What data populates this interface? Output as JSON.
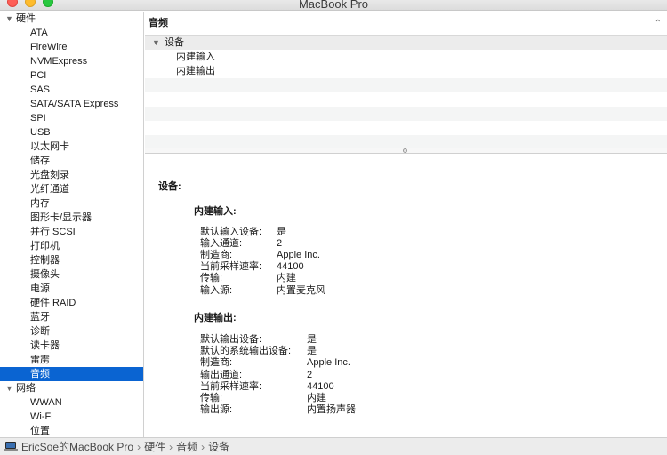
{
  "window": {
    "title": "MacBook Pro"
  },
  "sidebar": {
    "groups": [
      {
        "label": "硬件",
        "expanded": true,
        "items": [
          "ATA",
          "FireWire",
          "NVMExpress",
          "PCI",
          "SAS",
          "SATA/SATA Express",
          "SPI",
          "USB",
          "以太网卡",
          "储存",
          "光盘刻录",
          "光纤通道",
          "内存",
          "图形卡/显示器",
          "并行 SCSI",
          "打印机",
          "控制器",
          "摄像头",
          "电源",
          "硬件 RAID",
          "蓝牙",
          "诊断",
          "读卡器",
          "雷雳",
          "音频"
        ]
      },
      {
        "label": "网络",
        "expanded": true,
        "items": [
          "WWAN",
          "Wi-Fi",
          "位置"
        ]
      }
    ],
    "selected": "音频"
  },
  "table": {
    "header": "音频",
    "group_label": "设备",
    "rows": [
      "内建输入",
      "内建输出"
    ]
  },
  "detail": {
    "title": "设备:",
    "input": {
      "heading": "内建输入:",
      "fields": [
        {
          "key": "默认输入设备:",
          "value": "是"
        },
        {
          "key": "输入通道:",
          "value": "2"
        },
        {
          "key": "制造商:",
          "value": "Apple Inc."
        },
        {
          "key": "当前采样速率:",
          "value": "44100"
        },
        {
          "key": "传输:",
          "value": "内建"
        },
        {
          "key": "输入源:",
          "value": "内置麦克风"
        }
      ]
    },
    "output": {
      "heading": "内建输出:",
      "fields": [
        {
          "key": "默认输出设备:",
          "value": "是"
        },
        {
          "key": "默认的系统输出设备:",
          "value": "是"
        },
        {
          "key": "制造商:",
          "value": "Apple Inc."
        },
        {
          "key": "输出通道:",
          "value": "2"
        },
        {
          "key": "当前采样速率:",
          "value": "44100"
        },
        {
          "key": "传输:",
          "value": "内建"
        },
        {
          "key": "输出源:",
          "value": "内置扬声器"
        }
      ]
    }
  },
  "pathbar": {
    "segments": [
      "EricSoe的MacBook Pro",
      "硬件",
      "音频",
      "设备"
    ],
    "separator": "›"
  },
  "colors": {
    "selection": "#0a64d2",
    "close": "#fe5f57",
    "minimize": "#febc2e",
    "maximize": "#28c840"
  }
}
